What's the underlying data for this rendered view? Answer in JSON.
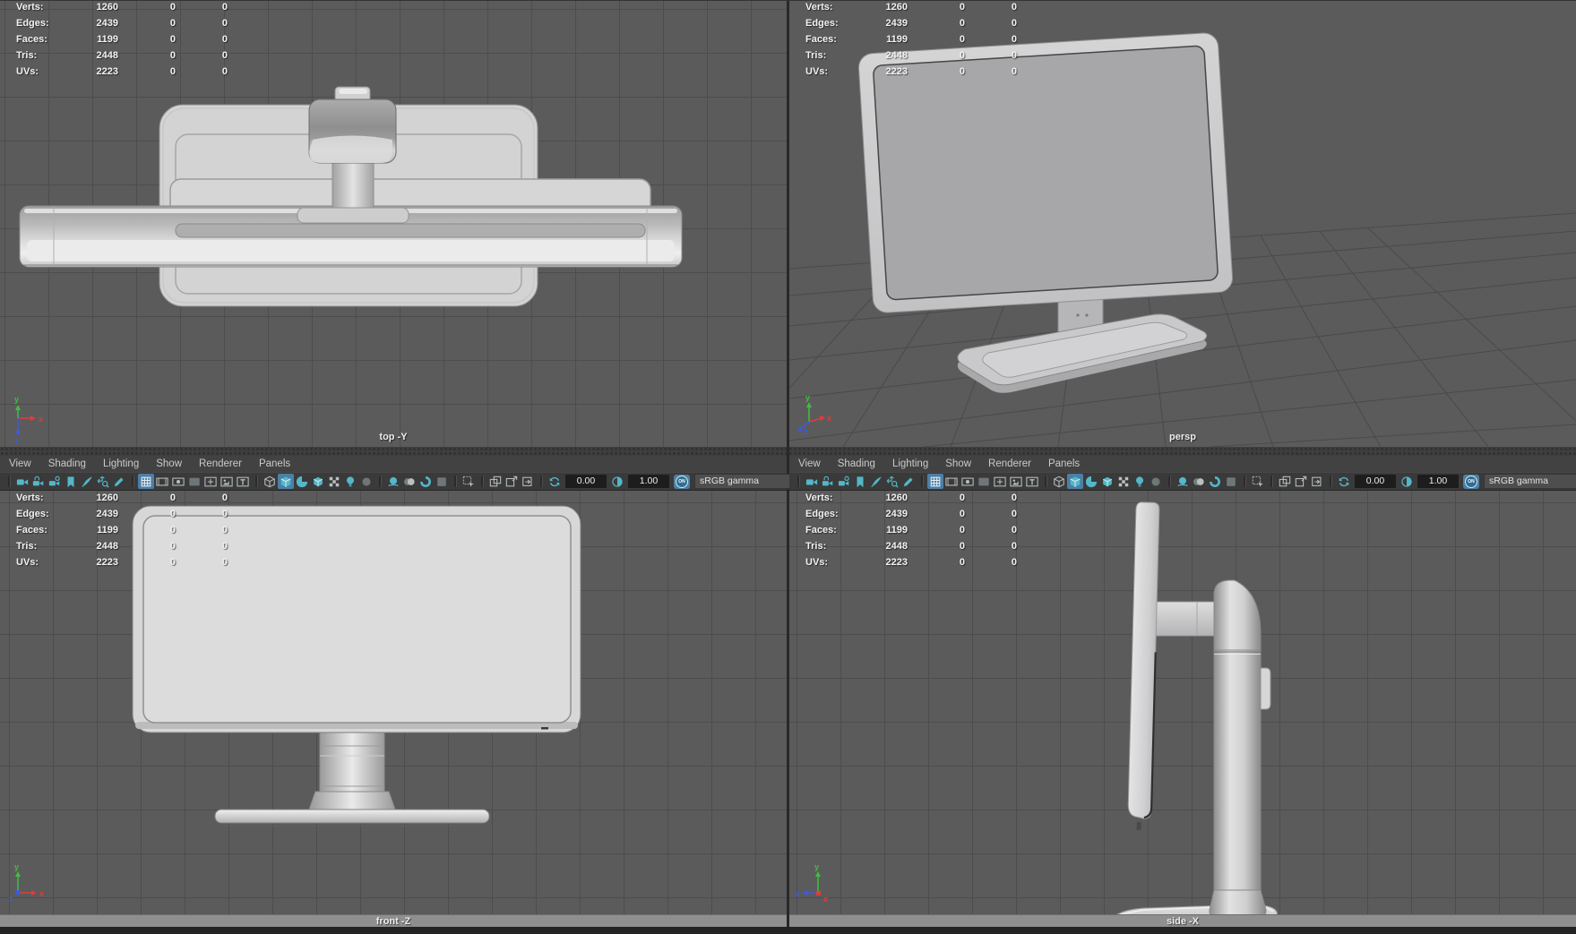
{
  "hud_stats": {
    "rows": [
      {
        "label": "Verts:",
        "total": "1260",
        "col2": "0",
        "col3": "0"
      },
      {
        "label": "Edges:",
        "total": "2439",
        "col2": "0",
        "col3": "0"
      },
      {
        "label": "Faces:",
        "total": "1199",
        "col2": "0",
        "col3": "0"
      },
      {
        "label": "Tris:",
        "total": "2448",
        "col2": "0",
        "col3": "0"
      },
      {
        "label": "UVs:",
        "total": "2223",
        "col2": "0",
        "col3": "0"
      }
    ]
  },
  "viewports": {
    "top_left": {
      "label": "top -Y"
    },
    "top_right": {
      "label": "persp"
    },
    "bottom_left": {
      "label": "front -Z"
    },
    "bottom_right": {
      "label": "side -X"
    }
  },
  "panel_menu": {
    "items": [
      "View",
      "Shading",
      "Lighting",
      "Show",
      "Renderer",
      "Panels"
    ]
  },
  "toolbar": {
    "items": [
      {
        "kind": "sep"
      },
      {
        "kind": "icon",
        "name": "camera-icon",
        "icon": "camera",
        "tint": "teal"
      },
      {
        "kind": "icon",
        "name": "camera-lock-icon",
        "icon": "cameralock",
        "tint": "teal"
      },
      {
        "kind": "icon",
        "name": "camera-attributes-icon",
        "icon": "camattr",
        "tint": "teal"
      },
      {
        "kind": "icon",
        "name": "bookmark-icon",
        "icon": "bookmark",
        "tint": "teal"
      },
      {
        "kind": "icon",
        "name": "image-plane-icon",
        "icon": "quill",
        "tint": "teal"
      },
      {
        "kind": "icon",
        "name": "pan-zoom-icon",
        "icon": "panzoom",
        "tint": "teal"
      },
      {
        "kind": "icon",
        "name": "grease-pencil-icon",
        "icon": "pencil",
        "tint": "teal"
      },
      {
        "kind": "sep"
      },
      {
        "kind": "icon",
        "name": "grid-toggle-button",
        "icon": "grid",
        "tint": "white",
        "active": true
      },
      {
        "kind": "icon",
        "name": "film-gate-button",
        "icon": "filmgate",
        "tint": "gray"
      },
      {
        "kind": "icon",
        "name": "resolution-gate-button",
        "icon": "resgate",
        "tint": "gray"
      },
      {
        "kind": "icon",
        "name": "gate-mask-button",
        "icon": "gatemask",
        "tint": "dim"
      },
      {
        "kind": "icon",
        "name": "field-chart-button",
        "icon": "fieldchart",
        "tint": "gray"
      },
      {
        "kind": "icon",
        "name": "safe-action-button",
        "icon": "safeaction",
        "tint": "gray"
      },
      {
        "kind": "icon",
        "name": "safe-title-button",
        "icon": "safetitle",
        "tint": "gray"
      },
      {
        "kind": "sep"
      },
      {
        "kind": "icon",
        "name": "wireframe-mode-button",
        "icon": "wirecube",
        "tint": "gray"
      },
      {
        "kind": "icon",
        "name": "shaded-mode-button",
        "icon": "shadedcube",
        "tint": "teal",
        "active": true
      },
      {
        "kind": "icon",
        "name": "textured-mode-button",
        "icon": "texsphere",
        "tint": "teal"
      },
      {
        "kind": "icon",
        "name": "wireframe-on-shaded-button",
        "icon": "woscube",
        "tint": "teal"
      },
      {
        "kind": "icon",
        "name": "default-material-button",
        "icon": "checker",
        "tint": "gray"
      },
      {
        "kind": "icon",
        "name": "lighting-button",
        "icon": "bulb",
        "tint": "teal"
      },
      {
        "kind": "icon",
        "name": "shadows-button",
        "icon": "shadowcircle",
        "tint": "dim"
      },
      {
        "kind": "sep"
      },
      {
        "kind": "icon",
        "name": "ambient-occlusion-button",
        "icon": "ssao",
        "tint": "teal"
      },
      {
        "kind": "icon",
        "name": "motion-blur-button",
        "icon": "mblur",
        "tint": "gray"
      },
      {
        "kind": "icon",
        "name": "anti-aliasing-button",
        "icon": "aacircle",
        "tint": "teal"
      },
      {
        "kind": "icon",
        "name": "aa-samples-button",
        "icon": "aabox",
        "tint": "dim"
      },
      {
        "kind": "sep"
      },
      {
        "kind": "icon",
        "name": "select-tool-button",
        "icon": "select",
        "tint": "gray"
      },
      {
        "kind": "sep"
      },
      {
        "kind": "icon",
        "name": "isolate-select-button",
        "icon": "iso1",
        "tint": "gray"
      },
      {
        "kind": "icon",
        "name": "isolate-add-button",
        "icon": "iso2",
        "tint": "gray"
      },
      {
        "kind": "icon",
        "name": "isolate-remove-button",
        "icon": "iso3",
        "tint": "gray"
      },
      {
        "kind": "sep"
      },
      {
        "kind": "icon",
        "name": "exposure-icon",
        "icon": "exposure",
        "tint": "teal"
      },
      {
        "kind": "field",
        "name": "exposure-field",
        "value": "0.00"
      },
      {
        "kind": "icon",
        "name": "gamma-icon",
        "icon": "gamma",
        "tint": "teal"
      },
      {
        "kind": "field",
        "name": "gamma-field",
        "value": "1.00"
      },
      {
        "kind": "toggle",
        "name": "color-management-toggle",
        "label": "ON"
      },
      {
        "kind": "field",
        "name": "view-transform-field",
        "value": "sRGB gamma",
        "wide": true
      }
    ]
  },
  "axis_labels": {
    "x": "x",
    "y": "y",
    "z": "z"
  },
  "colors": {
    "viewport_bg": "#5b5b5b",
    "grid_line": "#4d4d4d",
    "chrome_bg": "#424242",
    "active_button": "#4d7fa6",
    "icon_teal": "#54b7c8",
    "field_bg": "#1d1d1d",
    "model_light": "#d6d6d7",
    "model_mid": "#b5b5b7",
    "hud_text": "#f1f1f1"
  }
}
